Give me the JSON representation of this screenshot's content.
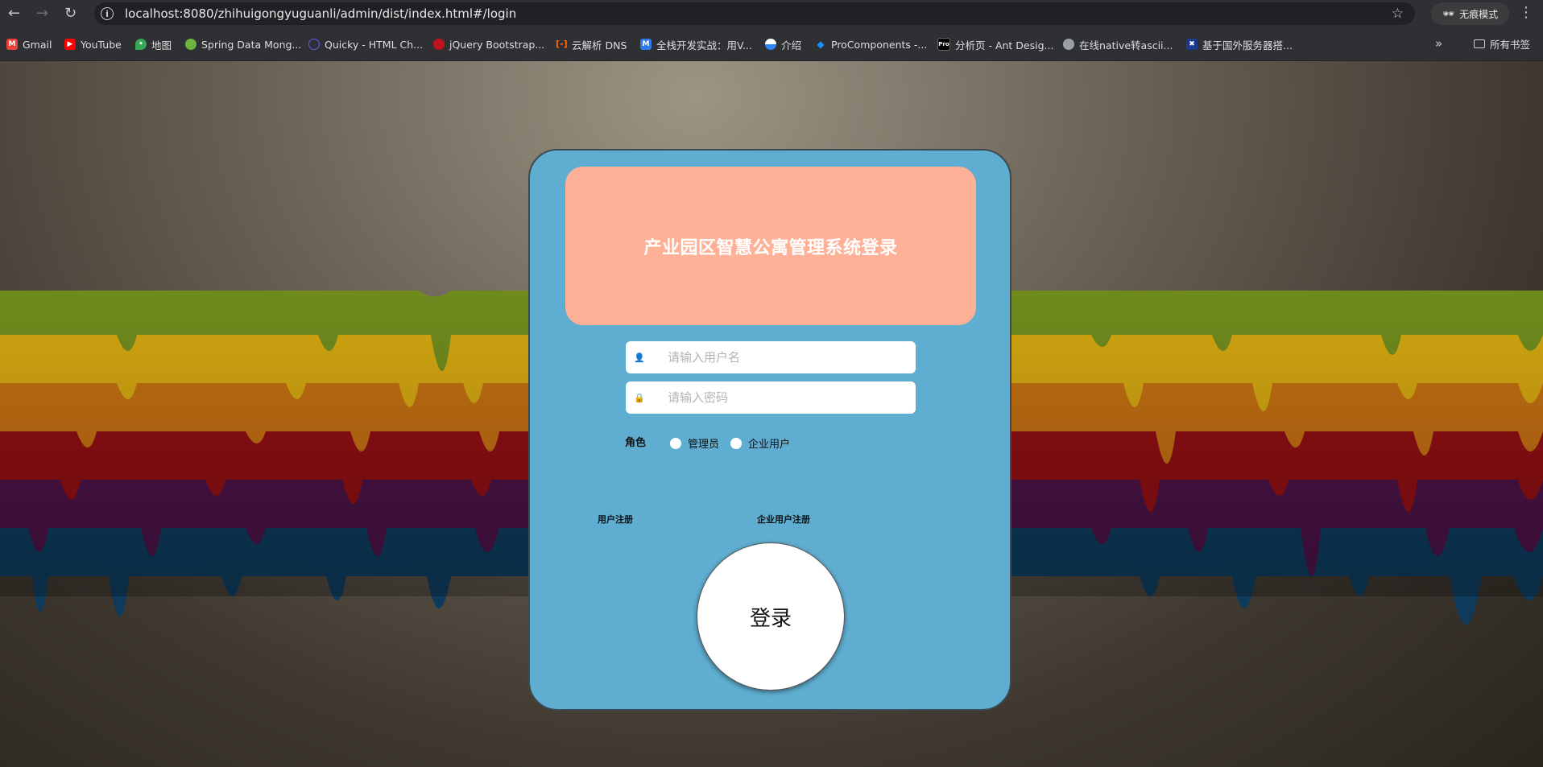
{
  "browser": {
    "url": "localhost:8080/zhihuigongyuguanli/admin/dist/index.html#/login",
    "incognito_label": "无痕模式",
    "all_bookmarks_label": "所有书签",
    "bookmarks": [
      {
        "label": "Gmail",
        "icon": "gmail-icon",
        "color": "#ea4335"
      },
      {
        "label": "YouTube",
        "icon": "youtube-icon",
        "color": "#ff0000"
      },
      {
        "label": "地图",
        "icon": "maps-icon",
        "color": "#34a853"
      },
      {
        "label": "Spring Data Mong...",
        "icon": "spring-icon",
        "color": "#6db33f"
      },
      {
        "label": "Quicky - HTML Ch...",
        "icon": "quicky-icon",
        "color": "#5b5fe8"
      },
      {
        "label": "jQuery Bootstrap...",
        "icon": "jquery-icon",
        "color": "#c0131b"
      },
      {
        "label": "云解析 DNS",
        "icon": "aliyun-icon",
        "color": "#ff6a00"
      },
      {
        "label": "全栈开发实战：用V...",
        "icon": "medium-icon",
        "color": "#2d7be5"
      },
      {
        "label": "介绍",
        "icon": "intro-icon",
        "color": "#2f86f6"
      },
      {
        "label": "ProComponents -...",
        "icon": "antd-icon",
        "color": "#1890ff"
      },
      {
        "label": "分析页 - Ant Desig...",
        "icon": "pro-icon",
        "color": "#000000"
      },
      {
        "label": "在线native转ascii...",
        "icon": "globe-icon",
        "color": "#9aa0a6"
      },
      {
        "label": "基于国外服务器搭...",
        "icon": "flag-icon",
        "color": "#1a3a8f"
      }
    ]
  },
  "login": {
    "title": "产业园区智慧公寓管理系统登录",
    "username_placeholder": "请输入用户名",
    "password_placeholder": "请输入密码",
    "role_label": "角色",
    "roles": [
      "管理员",
      "企业用户"
    ],
    "register_user": "用户注册",
    "register_company": "企业用户注册",
    "login_button": "登录"
  },
  "colors": {
    "card": "#5fadd0",
    "title_box": "#feb196"
  }
}
